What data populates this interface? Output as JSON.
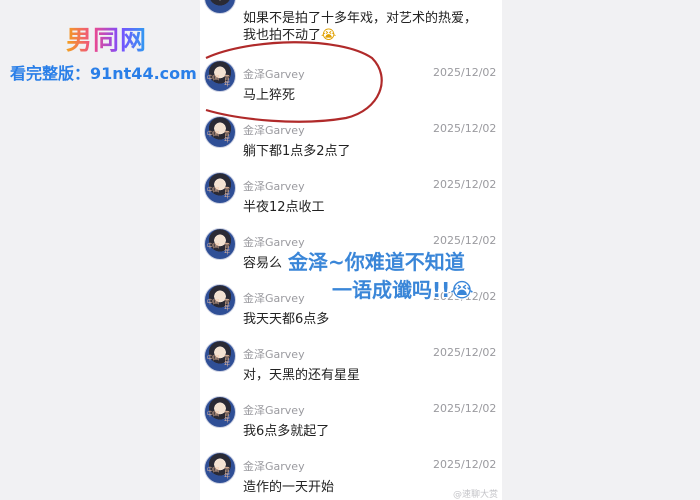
{
  "top_comment": {
    "line1": "如果不是拍了十多年戏，对艺术的热爱，",
    "line2": "我也拍不动了",
    "emoji": "😭"
  },
  "comments": [
    {
      "user": "金泽Garvey",
      "date": "2025/12/02",
      "text": "马上猝死"
    },
    {
      "user": "金泽Garvey",
      "date": "2025/12/02",
      "text": "躺下都1点多2点了"
    },
    {
      "user": "金泽Garvey",
      "date": "2025/12/02",
      "text": "半夜12点收工"
    },
    {
      "user": "金泽Garvey",
      "date": "2025/12/02",
      "text": "容易么"
    },
    {
      "user": "金泽Garvey",
      "date": "2025/12/02",
      "text": "我天天都6点多"
    },
    {
      "user": "金泽Garvey",
      "date": "2025/12/02",
      "text": "对，天黑的还有星星"
    },
    {
      "user": "金泽Garvey",
      "date": "2025/12/02",
      "text": "我6点多就起了"
    },
    {
      "user": "金泽Garvey",
      "date": "2025/12/02",
      "text": "造作的一天开始"
    }
  ],
  "avatar_glyphs": {
    "left": "中国",
    "right": "青年"
  },
  "overlay": {
    "line1": "金泽~你难道不知道",
    "line2": "一语成谶吗!!😭"
  },
  "watermark": {
    "logo": "男同网",
    "url": "看完整版：91nt44.com",
    "footer": "@速聊大赏"
  },
  "colors": {
    "overlay_text": "#3a86d8",
    "annotation_circle": "#b02a2a",
    "meta_text": "#9a9a9f"
  }
}
